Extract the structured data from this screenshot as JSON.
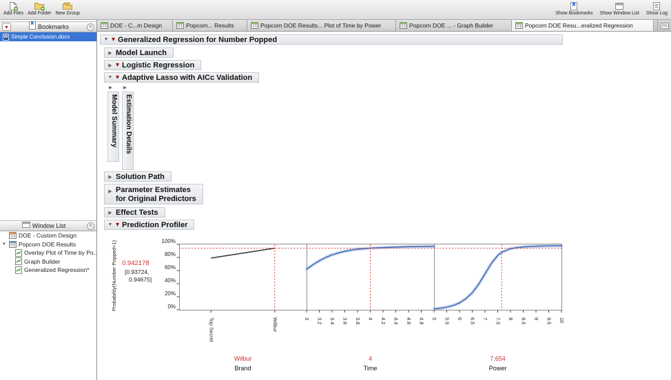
{
  "toolbar": {
    "left_buttons": [
      {
        "label": "Add Files",
        "icon": "add-files-icon"
      },
      {
        "label": "Add Folder",
        "icon": "add-folder-icon"
      },
      {
        "label": "New Group",
        "icon": "new-group-icon"
      }
    ],
    "right_buttons": [
      {
        "label": "Show Bookmarks",
        "icon": "show-bookmarks-icon"
      },
      {
        "label": "Show Window List",
        "icon": "show-window-list-icon"
      },
      {
        "label": "Show Log",
        "icon": "show-log-icon"
      }
    ]
  },
  "bookmarks_panel": {
    "title": "Bookmarks",
    "items": [
      {
        "label": "Simple Conclusion.docx",
        "selected": true,
        "icon": "word-doc-icon"
      }
    ]
  },
  "window_list_panel": {
    "title": "Window List",
    "items": [
      {
        "label": "DOE - Custom Design",
        "indent": 0,
        "icon": "data-table-icon"
      },
      {
        "label": "Popcorn DOE Results",
        "indent": 0,
        "expanded": true,
        "icon": "data-table-icon"
      },
      {
        "label": "Overlay Plot of Time by Po...",
        "indent": 1,
        "icon": "report-icon"
      },
      {
        "label": "Graph Builder",
        "indent": 1,
        "icon": "report-icon"
      },
      {
        "label": "Generalized Regression*",
        "indent": 1,
        "icon": "report-icon"
      }
    ]
  },
  "tabs": [
    {
      "label": "DOE - C...m Design",
      "active": false
    },
    {
      "label": "Popcorn... Results",
      "active": false
    },
    {
      "label": "Popcorn DOE Results... Plot of Time by Power",
      "active": false
    },
    {
      "label": "Popcorn DOE ... - Graph Builder",
      "active": false
    },
    {
      "label": "Popcorn DOE Resu...eralized Regression",
      "active": true
    }
  ],
  "report": {
    "title": "Generalized Regression for Number Popped",
    "model_launch": "Model Launch",
    "logistic": "Logistic Regression",
    "adaptive_lasso": "Adaptive Lasso with AICc Validation",
    "collapsed_vertical": [
      "Model Summary",
      "Estimation Details"
    ],
    "solution_path": "Solution Path",
    "param_estimates_line1": "Parameter Estimates",
    "param_estimates_line2": "for Original Predictors",
    "effect_tests": "Effect Tests",
    "prediction_profiler": "Prediction Profiler"
  },
  "profiler": {
    "y_axis_label": "Probability(Number Popped=1)",
    "predicted_value": "0.942178",
    "ci_line1": "[0.93724,",
    "ci_line2": "0.94675]",
    "current_pct": 94.2,
    "y_ticks": [
      {
        "label": "100%",
        "pct": 100
      },
      {
        "label": "80%",
        "pct": 80
      },
      {
        "label": "60%",
        "pct": 60
      },
      {
        "label": "40%",
        "pct": 40
      },
      {
        "label": "20%",
        "pct": 20
      },
      {
        "label": "0%",
        "pct": 0
      }
    ],
    "colors": {
      "curve_blue": "#3a66b8",
      "trace_dark": "#303030",
      "cursor_red": "#e03a3a",
      "value_red": "#d03030"
    },
    "panels": [
      {
        "factor": "Brand",
        "current_value": "Wilbur",
        "cursor_frac": 0.75,
        "band": false,
        "ticks": [
          {
            "label": "Top Secret",
            "frac": 0.25
          },
          {
            "label": "Wilbur",
            "frac": 0.75
          }
        ],
        "curve": [
          [
            0.25,
            79
          ],
          [
            0.75,
            94.2
          ]
        ]
      },
      {
        "factor": "Time",
        "current_value": "4",
        "cursor_frac": 0.5,
        "band": true,
        "axis_min": 3,
        "axis_max": 5,
        "ticks": [
          {
            "label": "3",
            "frac": 0.0
          },
          {
            "label": "3.2",
            "frac": 0.1
          },
          {
            "label": "3.4",
            "frac": 0.2
          },
          {
            "label": "3.6",
            "frac": 0.3
          },
          {
            "label": "3.8",
            "frac": 0.4
          },
          {
            "label": "4",
            "frac": 0.5
          },
          {
            "label": "4.2",
            "frac": 0.6
          },
          {
            "label": "4.4",
            "frac": 0.7
          },
          {
            "label": "4.6",
            "frac": 0.8
          },
          {
            "label": "4.8",
            "frac": 0.9
          }
        ],
        "curve": [
          [
            0,
            62
          ],
          [
            0.05,
            69
          ],
          [
            0.1,
            75
          ],
          [
            0.15,
            80
          ],
          [
            0.2,
            84
          ],
          [
            0.25,
            87
          ],
          [
            0.3,
            89.5
          ],
          [
            0.35,
            91.3
          ],
          [
            0.4,
            92.6
          ],
          [
            0.45,
            93.5
          ],
          [
            0.5,
            94.2
          ],
          [
            0.6,
            95.2
          ],
          [
            0.7,
            95.9
          ],
          [
            0.8,
            96.4
          ],
          [
            0.9,
            96.7
          ],
          [
            1,
            97
          ]
        ]
      },
      {
        "factor": "Power",
        "current_value": "7.654",
        "cursor_frac": 0.531,
        "band": true,
        "axis_min": 5,
        "axis_max": 10,
        "ticks": [
          {
            "label": "5",
            "frac": 0.0
          },
          {
            "label": "5.5",
            "frac": 0.1
          },
          {
            "label": "6",
            "frac": 0.2
          },
          {
            "label": "6.5",
            "frac": 0.3
          },
          {
            "label": "7",
            "frac": 0.4
          },
          {
            "label": "7.5",
            "frac": 0.5
          },
          {
            "label": "8",
            "frac": 0.6
          },
          {
            "label": "8.5",
            "frac": 0.7
          },
          {
            "label": "9",
            "frac": 0.8
          },
          {
            "label": "9.5",
            "frac": 0.9
          },
          {
            "label": "10",
            "frac": 1.0
          }
        ],
        "curve": [
          [
            0,
            1.5
          ],
          [
            0.05,
            2.5
          ],
          [
            0.1,
            4
          ],
          [
            0.15,
            6.5
          ],
          [
            0.2,
            10.5
          ],
          [
            0.25,
            17
          ],
          [
            0.3,
            26
          ],
          [
            0.35,
            39
          ],
          [
            0.4,
            55
          ],
          [
            0.45,
            71
          ],
          [
            0.5,
            83
          ],
          [
            0.531,
            88
          ],
          [
            0.6,
            93.5
          ],
          [
            0.65,
            95
          ],
          [
            0.7,
            96.2
          ],
          [
            0.8,
            97.3
          ],
          [
            0.9,
            97.8
          ],
          [
            1,
            98
          ]
        ]
      }
    ]
  },
  "colors": {
    "selection_blue": "#3875d7",
    "red_triangle": "#b40000",
    "profiler_curve_blue": "#3a66b8",
    "profiler_cursor_red": "#e03a3a",
    "value_red": "#d03030"
  }
}
